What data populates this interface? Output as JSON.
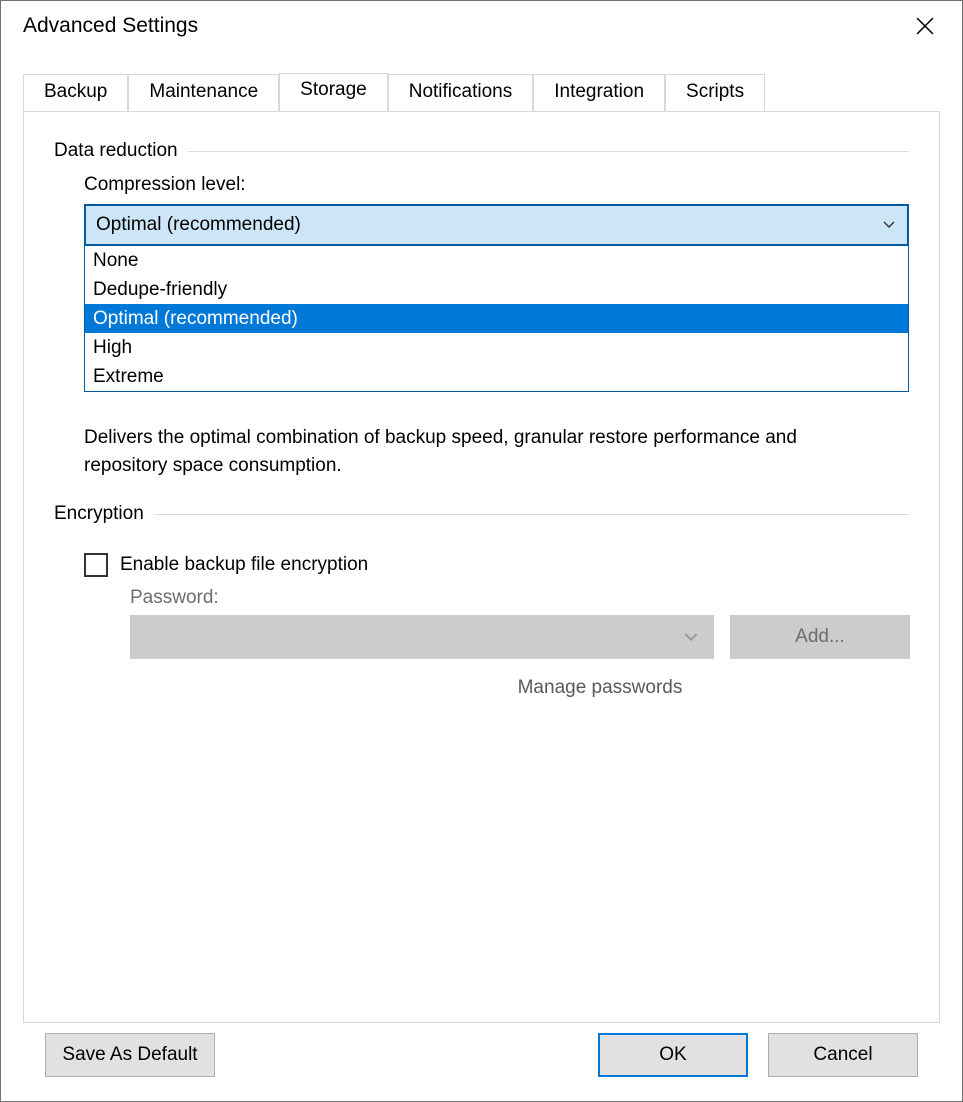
{
  "window": {
    "title": "Advanced Settings"
  },
  "tabs": {
    "items": [
      "Backup",
      "Maintenance",
      "Storage",
      "Notifications",
      "Integration",
      "Scripts"
    ],
    "active_index": 2
  },
  "storage": {
    "data_reduction": {
      "group_label": "Data reduction",
      "compression_label": "Compression level:",
      "compression_value": "Optimal (recommended)",
      "compression_options": [
        "None",
        "Dedupe-friendly",
        "Optimal (recommended)",
        "High",
        "Extreme"
      ],
      "compression_selected_index": 2,
      "description": "Delivers the optimal combination of backup speed, granular restore performance and repository space consumption."
    },
    "encryption": {
      "group_label": "Encryption",
      "checkbox_label": "Enable backup file encryption",
      "checkbox_checked": false,
      "password_label": "Password:",
      "password_value": "",
      "add_button": "Add...",
      "manage_link": "Manage passwords"
    }
  },
  "footer": {
    "save_default": "Save As Default",
    "ok": "OK",
    "cancel": "Cancel"
  }
}
